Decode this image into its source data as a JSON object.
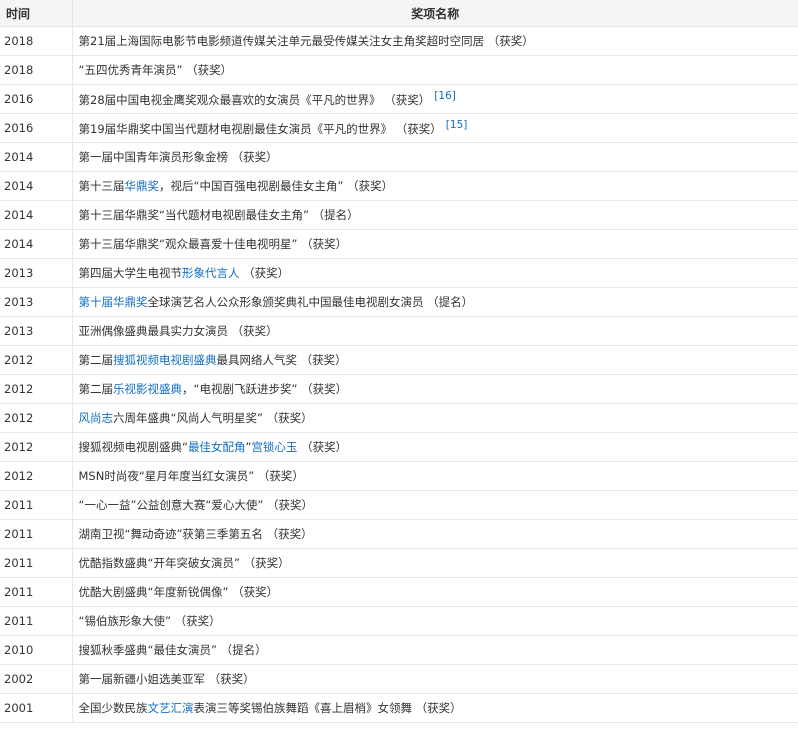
{
  "table": {
    "headers": {
      "year": "时间",
      "award": "奖项名称"
    },
    "colors": {
      "link": "#136ec2",
      "header_bg": "#f5f5f5",
      "text": "#333333"
    },
    "rows": [
      {
        "year": "2018",
        "segments": [
          {
            "text": "第21届上海国际电影节电影频道传媒关注单元最受传媒关注女主角奖超时空同居 （获奖）",
            "link": false
          }
        ]
      },
      {
        "year": "2018",
        "segments": [
          {
            "text": "“五四优秀青年演员” （获奖）",
            "link": false
          }
        ]
      },
      {
        "year": "2016",
        "segments": [
          {
            "text": "第28届中国电视金鹰奖观众最喜欢的女演员《平凡的世界》 （获奖）",
            "link": false
          }
        ],
        "ref": "[16]"
      },
      {
        "year": "2016",
        "segments": [
          {
            "text": "第19届华鼎奖中国当代题材电视剧最佳女演员《平凡的世界》 （获奖）",
            "link": false
          }
        ],
        "ref": "[15]"
      },
      {
        "year": "2014",
        "segments": [
          {
            "text": "第一届中国青年演员形象金榜 （获奖）",
            "link": false
          }
        ]
      },
      {
        "year": "2014",
        "segments": [
          {
            "text": "第十三届",
            "link": false
          },
          {
            "text": "华鼎奖",
            "link": true
          },
          {
            "text": "，视后“中国百强电视剧最佳女主角” （获奖）",
            "link": false
          }
        ]
      },
      {
        "year": "2014",
        "segments": [
          {
            "text": "第十三届华鼎奖“当代题材电视剧最佳女主角” （提名）",
            "link": false
          }
        ]
      },
      {
        "year": "2014",
        "segments": [
          {
            "text": "第十三届华鼎奖“观众最喜爱十佳电视明星” （获奖）",
            "link": false
          }
        ]
      },
      {
        "year": "2013",
        "segments": [
          {
            "text": "第四届大学生电视节",
            "link": false
          },
          {
            "text": "形象代言人",
            "link": true
          },
          {
            "text": " （获奖）",
            "link": false
          }
        ]
      },
      {
        "year": "2013",
        "segments": [
          {
            "text": "第十届华鼎奖",
            "link": true
          },
          {
            "text": "全球演艺名人公众形象颁奖典礼中国最佳电视剧女演员 （提名）",
            "link": false
          }
        ]
      },
      {
        "year": "2013",
        "segments": [
          {
            "text": "亚洲偶像盛典最具实力女演员 （获奖）",
            "link": false
          }
        ]
      },
      {
        "year": "2012",
        "segments": [
          {
            "text": "第二届",
            "link": false
          },
          {
            "text": "搜狐视频电视剧盛典",
            "link": true
          },
          {
            "text": "最具网络人气奖 （获奖）",
            "link": false
          }
        ]
      },
      {
        "year": "2012",
        "segments": [
          {
            "text": "第二届",
            "link": false
          },
          {
            "text": "乐视影视盛典",
            "link": true
          },
          {
            "text": "，“电视剧飞跃进步奖” （获奖）",
            "link": false
          }
        ]
      },
      {
        "year": "2012",
        "segments": [
          {
            "text": "风尚志",
            "link": true
          },
          {
            "text": "六周年盛典“风尚人气明星奖” （获奖）",
            "link": false
          }
        ]
      },
      {
        "year": "2012",
        "segments": [
          {
            "text": "搜狐视频电视剧盛典“",
            "link": false
          },
          {
            "text": "最佳女配角",
            "link": true
          },
          {
            "text": "”",
            "link": false
          },
          {
            "text": "宫锁心玉",
            "link": true
          },
          {
            "text": " （获奖）",
            "link": false
          }
        ]
      },
      {
        "year": "2012",
        "segments": [
          {
            "text": "MSN时尚夜“星月年度当红女演员” （获奖）",
            "link": false
          }
        ]
      },
      {
        "year": "2011",
        "segments": [
          {
            "text": "“一心一益”公益创意大赛“爱心大使” （获奖）",
            "link": false
          }
        ]
      },
      {
        "year": "2011",
        "segments": [
          {
            "text": "湖南卫视“舞动奇迹”获第三季第五名 （获奖）",
            "link": false
          }
        ]
      },
      {
        "year": "2011",
        "segments": [
          {
            "text": "优酷指数盛典“开年突破女演员” （获奖）",
            "link": false
          }
        ]
      },
      {
        "year": "2011",
        "segments": [
          {
            "text": "优酷大剧盛典“年度新锐偶像” （获奖）",
            "link": false
          }
        ]
      },
      {
        "year": "2011",
        "segments": [
          {
            "text": "“锡伯族形象大使” （获奖）",
            "link": false
          }
        ]
      },
      {
        "year": "2010",
        "segments": [
          {
            "text": "搜狐秋季盛典“最佳女演员” （提名）",
            "link": false
          }
        ]
      },
      {
        "year": "2002",
        "segments": [
          {
            "text": "第一届新疆小姐选美亚军 （获奖）",
            "link": false
          }
        ]
      },
      {
        "year": "2001",
        "segments": [
          {
            "text": "全国少数民族",
            "link": false
          },
          {
            "text": "文艺汇演",
            "link": true
          },
          {
            "text": "表演三等奖锡伯族舞蹈《喜上眉梢》女领舞 （获奖）",
            "link": false
          }
        ]
      }
    ]
  }
}
